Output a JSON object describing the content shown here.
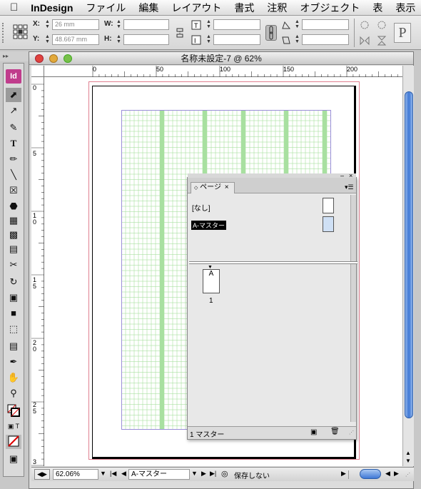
{
  "menubar": {
    "app_name": "InDesign",
    "items": [
      "ファイル",
      "編集",
      "レイアウト",
      "書式",
      "注釈",
      "オブジェクト",
      "表",
      "表示"
    ]
  },
  "control": {
    "x_label": "X:",
    "x_value": "26 mm",
    "y_label": "Y:",
    "y_value": "48.667 mm",
    "w_label": "W:",
    "h_label": "H:"
  },
  "window": {
    "title": "名称未設定-7 @ 62%"
  },
  "ruler": {
    "h_ticks": [
      "0",
      "50",
      "100",
      "150",
      "200"
    ],
    "v_ticks": [
      "0",
      "5",
      "1 0",
      "1 5",
      "2 0",
      "2 5",
      "3"
    ]
  },
  "pages_panel": {
    "tab_label": "ページ",
    "none_label": "[なし]",
    "master_label": "A-マスター",
    "page_master_letter": "A",
    "page_number": "1",
    "footer_label": "1 マスター"
  },
  "statusbar": {
    "zoom": "62.06%",
    "page_field": "A-マスター",
    "save_status": "保存しない"
  },
  "colors": {
    "grid_green": "#a8e0a0",
    "margin_pink": "#e08090",
    "selection_blue": "#cfe0f5",
    "scroll_blue": "#3f78d6"
  }
}
